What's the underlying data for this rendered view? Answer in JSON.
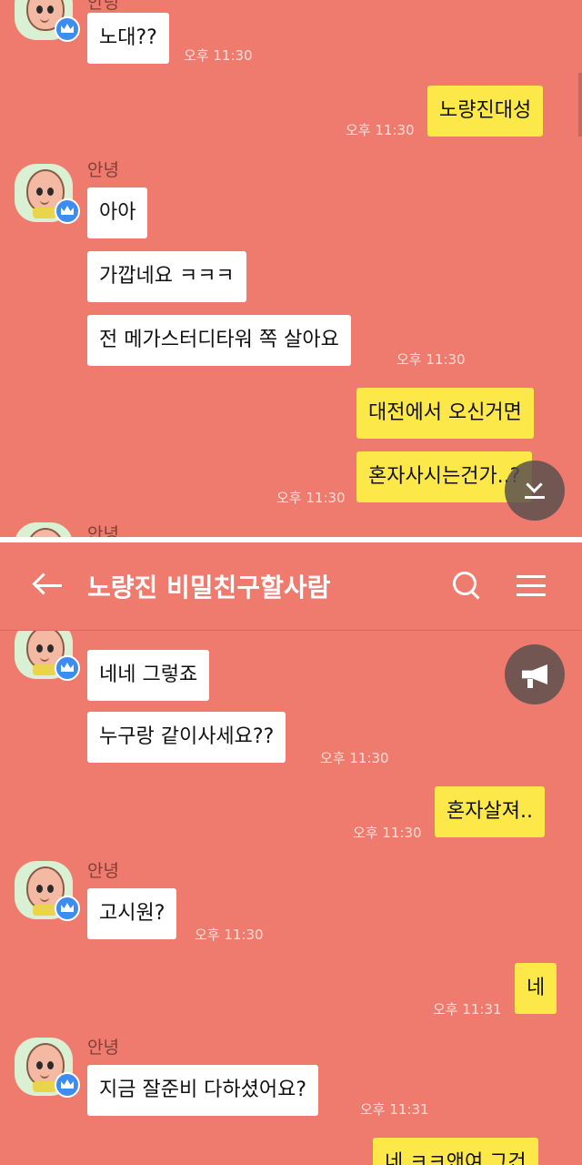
{
  "partner_name": "안녕",
  "top_sender_partial": "안녕",
  "room_title": "노량진 비밀친구할사람",
  "colors": {
    "background": "#ef7b6f",
    "incoming_bubble": "#ffffff",
    "outgoing_bubble": "#fde84a",
    "badge": "#3d8cf0"
  },
  "icons": {
    "back": "back-arrow-icon",
    "search": "search-icon",
    "menu": "hamburger-menu-icon",
    "scroll": "scroll-to-bottom-icon",
    "notice": "megaphone-icon"
  },
  "screen1": {
    "m1": {
      "text": "노대??",
      "time": "오후 11:30"
    },
    "m2": {
      "text": "노량진대성",
      "time": "오후 11:30"
    },
    "m3": {
      "text": "아아"
    },
    "m4": {
      "text": "가깝네요 ㅋㅋㅋ"
    },
    "m5": {
      "text": "전 메가스터디타워 쪽 살아요",
      "time": "오후 11:30"
    },
    "m6": {
      "text": "대전에서 오신거면"
    },
    "m7": {
      "text": "혼자사시는건가..?",
      "time": "오후 11:30"
    }
  },
  "screen2": {
    "m1": {
      "text": "네네 그렇죠"
    },
    "m2": {
      "text": "누구랑 같이사세요??",
      "time": "오후 11:30"
    },
    "m3": {
      "text": "혼자살져..",
      "time": "오후 11:30"
    },
    "m4": {
      "text": "고시원?",
      "time": "오후 11:30"
    },
    "m5": {
      "text": "네",
      "time": "오후 11:31"
    },
    "m6": {
      "text": "지금 잘준비 다하셨어요?",
      "time": "오후 11:31"
    },
    "m7": {
      "text": "네 ㅋㅋ앤여 그건"
    }
  }
}
